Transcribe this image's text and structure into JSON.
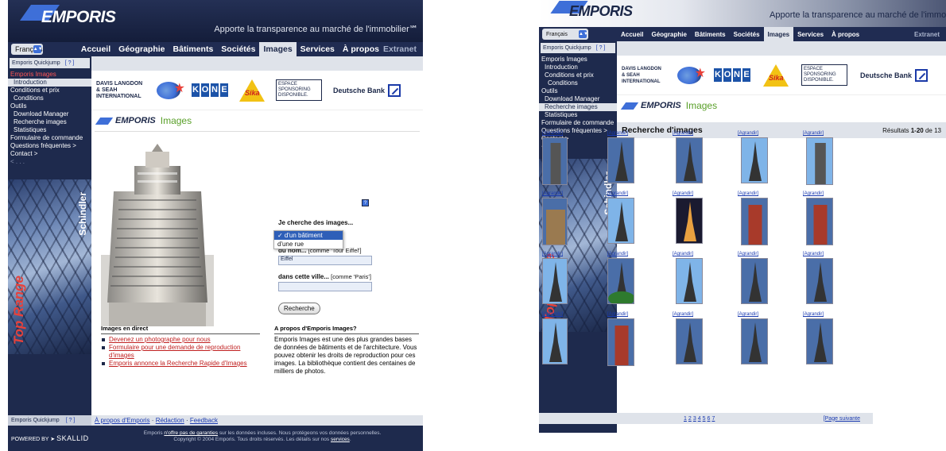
{
  "header": {
    "logo": "EMPORIS",
    "tagline": "Apporte la transparence au marché de l'immobilier℠"
  },
  "header_right": {
    "tagline": "Apporte la transparence au marché de l'immobilier"
  },
  "language": "Français",
  "nav": [
    "Accueil",
    "Géographie",
    "Bâtiments",
    "Sociétés",
    "Images",
    "Services",
    "À propos"
  ],
  "nav_active": "Images",
  "extranet": "Extranet",
  "quickjump": {
    "label": "Emporis Quickjump",
    "help": "[ ? ]"
  },
  "sidebar": {
    "left": [
      {
        "label": "Emporis Images",
        "level": 0
      },
      {
        "label": "Introduction",
        "level": 1
      },
      {
        "label": "Conditions et prix",
        "level": 0
      },
      {
        "label": "Conditions",
        "level": 1
      },
      {
        "label": "Outils",
        "level": 0
      },
      {
        "label": "Download Manager",
        "level": 1
      },
      {
        "label": "Recherche images",
        "level": 1
      },
      {
        "label": "Statistiques",
        "level": 1
      },
      {
        "label": "Formulaire de commande",
        "level": 0
      },
      {
        "label": "Questions fréquentes >",
        "level": 0
      },
      {
        "label": "Contact >",
        "level": 0
      },
      {
        "label": "< . . .",
        "level": 0
      }
    ],
    "right": [
      {
        "label": "Emporis Images",
        "level": 0
      },
      {
        "label": "Introduction",
        "level": 1
      },
      {
        "label": "Conditions et prix",
        "level": 1
      },
      {
        "label": "Conditions",
        "level": 2
      },
      {
        "label": "Outils",
        "level": 0
      },
      {
        "label": "Download Manager",
        "level": 1
      },
      {
        "label": "Recherche images",
        "level": 1
      },
      {
        "label": "Statistiques",
        "level": 1
      },
      {
        "label": "Formulaire de commande",
        "level": 0
      },
      {
        "label": "Questions fréquentes >",
        "level": 0
      },
      {
        "label": "Contact >",
        "level": 0
      },
      {
        "label": "< . . .",
        "level": 0
      }
    ]
  },
  "banner": {
    "brand": "Schindler",
    "tag": "Top Range"
  },
  "sponsors": {
    "dl": "DAVIS LANGDON & SEAH INTERNATIONAL",
    "kone": [
      "K",
      "O",
      "N",
      "E"
    ],
    "sika": "Sika",
    "box": "ESPACE SPONSORING DISPONIBLE.",
    "db": "Deutsche Bank"
  },
  "page": {
    "logo": "EMPORIS",
    "title": "Images"
  },
  "form": {
    "help": "?",
    "heading": "Je cherche des images...",
    "options": [
      "✓ d'un bâtiment",
      "d'une rue"
    ],
    "name_label": "du nom...",
    "name_hint": "[comme 'Tour Eiffel']",
    "name_value": "Eiffel",
    "city_label": "dans cette ville...",
    "city_hint": "[comme 'Paris']",
    "city_value": "",
    "button": "Recherche"
  },
  "direct": {
    "heading": "Images en direct",
    "links": [
      "Devenez un photographe pour nous",
      "Formulaire pour une demande de reproduction d'images",
      "Emporis annonce la Recherche Rapide d'Images"
    ]
  },
  "about": {
    "heading": "A propos d'Emporis Images?",
    "text": "Emporis Images est une des plus grandes bases de données de bâtiments et de l'architecture. Vous pouvez obtenir les droits de reproduction pour ces images. La bibliothèque contient des centaines de milliers de photos."
  },
  "footer": {
    "links": [
      "À propos d'Emporis",
      "Rédaction",
      "Feedback"
    ],
    "sep": "·"
  },
  "legal": {
    "line1a": "Emporis ",
    "line1link": "n'offre pas de garanties",
    "line1b": " sur les données incluses. Nous protégeons vos données personnelles.",
    "line2a": "Copyright © 2004 Emporis. Tous droits réservés. Les détails sur nos ",
    "line2link": "services",
    "line2b": "."
  },
  "powered": {
    "label": "POWERED BY",
    "brand": "SKALLID"
  },
  "results": {
    "title": "Recherche d'images",
    "prefix": "Résultats ",
    "range": "1-20",
    "suffix": " de 13",
    "enlarge": "[Agrandir]",
    "pages": [
      "1",
      "2",
      "3",
      "4",
      "5",
      "6",
      "7"
    ],
    "next": "[Page suivante"
  }
}
